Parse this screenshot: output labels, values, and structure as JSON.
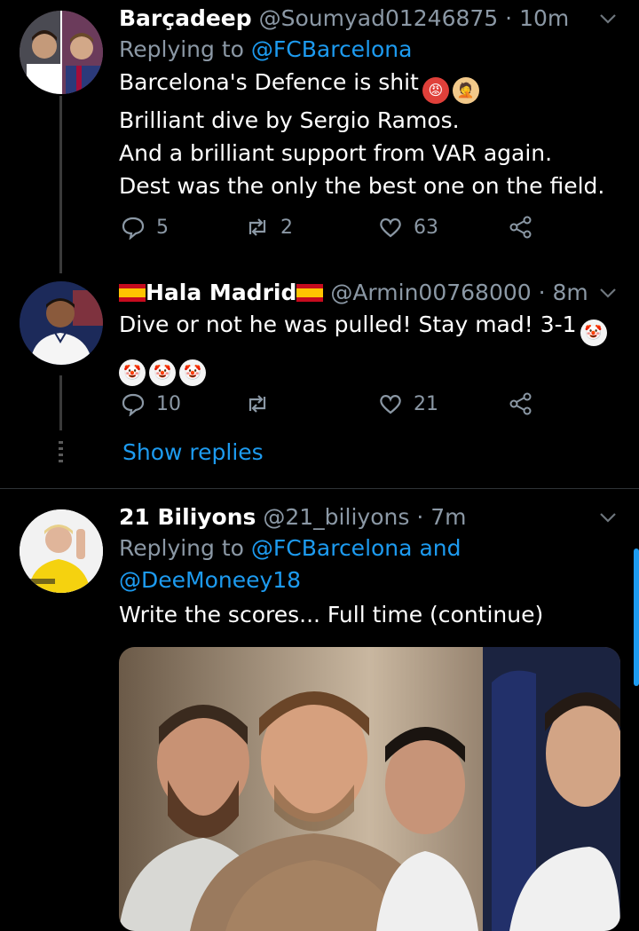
{
  "tweets": [
    {
      "display_name": "Barçadeep",
      "handle": "@Soumyad01246875",
      "separator": "·",
      "time": "10m",
      "replying_prefix": "Replying to",
      "replying_to": "@FCBarcelona",
      "lines": [
        "Barcelona's Defence is shit",
        "Brilliant dive by Sergio Ramos.",
        "And a brilliant support from VAR again.",
        "Dest was the only the best one on the field."
      ],
      "emoji": [
        "angry-face-emoji",
        "person-facepalming-emoji"
      ],
      "reply_count": "5",
      "retweet_count": "2",
      "like_count": "63"
    },
    {
      "display_name": "Hala Madrid",
      "handle": "@Armin00768000",
      "separator": "·",
      "time": "8m",
      "lines": [
        "Dive or not he was pulled! Stay mad! 3-1"
      ],
      "emoji": [
        "spain-flag",
        "clown-face-emoji"
      ],
      "reply_count": "10",
      "retweet_count": "",
      "like_count": "21",
      "show_replies": "Show replies"
    },
    {
      "display_name": "21 Biliyons",
      "handle": "@21_biliyons",
      "separator": "·",
      "time": "7m",
      "replying_prefix": "Replying to",
      "replying_to": "@FCBarcelona",
      "replying_and": "and",
      "replying_to_2": "@DeeMoneey18",
      "lines": [
        "Write the scores... Full time (continue)"
      ],
      "media_alt": "photo"
    }
  ],
  "colors": {
    "background": "#000000",
    "link": "#1d9bf0",
    "secondary_text": "#8b98a5"
  }
}
